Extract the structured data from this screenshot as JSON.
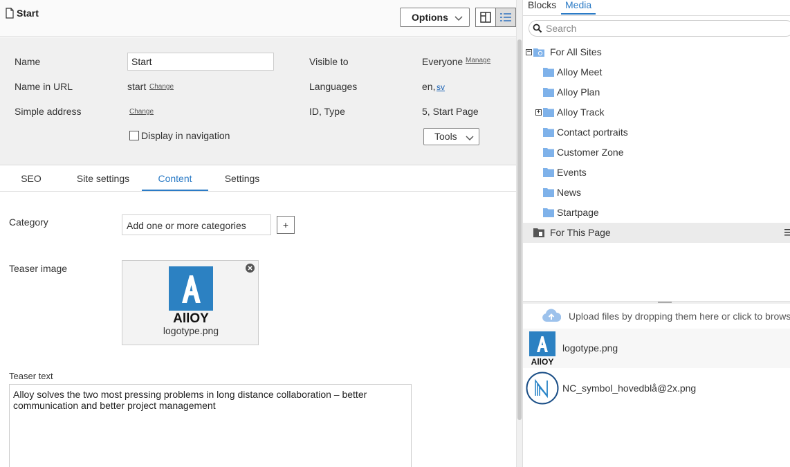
{
  "header": {
    "page_title": "Start",
    "options_label": "Options"
  },
  "properties": {
    "name_label": "Name",
    "name_value": "Start",
    "name_in_url_label": "Name in URL",
    "name_in_url_value": "start",
    "name_in_url_change": "Change",
    "simple_address_label": "Simple address",
    "simple_address_change": "Change",
    "display_in_navigation_label": "Display in navigation",
    "visible_to_label": "Visible to",
    "visible_to_value": "Everyone",
    "visible_to_manage": "Manage",
    "languages_label": "Languages",
    "languages_value": "en,",
    "languages_link": "sv",
    "id_type_label": "ID, Type",
    "id_type_value": "5, Start Page",
    "tools_label": "Tools"
  },
  "tabs": [
    {
      "label": "SEO"
    },
    {
      "label": "Site settings"
    },
    {
      "label": "Content",
      "active": true
    },
    {
      "label": "Settings"
    }
  ],
  "content": {
    "category_label": "Category",
    "category_placeholder": "Add one or more categories",
    "category_add": "+",
    "teaser_image_label": "Teaser image",
    "teaser_image_file": "logotype.png",
    "teaser_text_label": "Teaser text",
    "teaser_text_value": "Alloy solves the two most pressing problems in long distance collaboration – better communication and better project management"
  },
  "assets": {
    "tabs": [
      {
        "label": "Blocks"
      },
      {
        "label": "Media",
        "active": true
      }
    ],
    "search_placeholder": "Search",
    "tree": [
      {
        "label": "For All Sites",
        "icon": "globe-folder-icon",
        "expander": "−"
      },
      {
        "label": "Alloy Meet",
        "icon": "folder-icon"
      },
      {
        "label": "Alloy Plan",
        "icon": "folder-icon"
      },
      {
        "label": "Alloy Track",
        "icon": "folder-icon",
        "expander": "+"
      },
      {
        "label": "Contact portraits",
        "icon": "folder-icon"
      },
      {
        "label": "Customer Zone",
        "icon": "folder-icon"
      },
      {
        "label": "Events",
        "icon": "folder-icon"
      },
      {
        "label": "News",
        "icon": "folder-icon"
      },
      {
        "label": "Startpage",
        "icon": "folder-icon"
      },
      {
        "label": "For This Page",
        "icon": "page-folder-icon",
        "selected": true
      }
    ],
    "upload_text": "Upload files by dropping them here or click to browse",
    "media": [
      {
        "name": "logotype.png",
        "thumb": "alloy-logo-icon"
      },
      {
        "name": "NC_symbol_hovedblå@2x.png",
        "thumb": "nc-symbol-icon"
      }
    ]
  },
  "colors": {
    "accent": "#2b7bc6",
    "folder": "#7fb2ea",
    "alloy_blue": "#2c81c2",
    "panel_bg": "#f0f0f0"
  }
}
